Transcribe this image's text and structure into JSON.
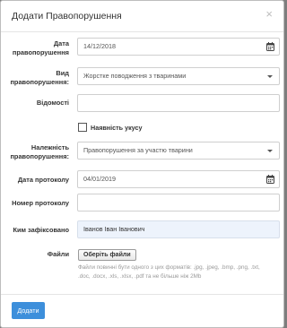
{
  "dialog": {
    "title": "Додати Правопорушення",
    "close_glyph": "×"
  },
  "form": {
    "offense_date": {
      "label": "Дата правопорушення",
      "value": "14/12/2018"
    },
    "offense_type": {
      "label": "Вид правопорушення:",
      "value": "Жорстке поводження з тваринами"
    },
    "information": {
      "label": "Відомості",
      "value": ""
    },
    "bite": {
      "label": "Наявність укусу",
      "checked": false
    },
    "belonging": {
      "label": "Належність правопорушення:",
      "value": "Правопорушення за участю тварини"
    },
    "protocol_date": {
      "label": "Дата протоколу",
      "value": "04/01/2019"
    },
    "protocol_number": {
      "label": "Номер протоколу",
      "value": ""
    },
    "recorded_by": {
      "label": "Ким зафіксовано",
      "value": "Іванов Іван Іванович"
    },
    "files": {
      "label": "Файли",
      "button_label": "Оберіть файли",
      "hint": "Файли повинні бути одного з цих форматів: .jpg, .jpeg, .bmp, .png, .txt, .doc, .docx, .xls, .xlsx, .pdf та не більше ніж 2Mb"
    }
  },
  "footer": {
    "submit_label": "Додати"
  },
  "colors": {
    "accent": "#3d8fdb",
    "readonly_bg": "#edf3fc",
    "overlay": "#7d7d7d"
  },
  "icons": [
    "close-icon",
    "calendar-icon",
    "chevron-down-icon"
  ]
}
